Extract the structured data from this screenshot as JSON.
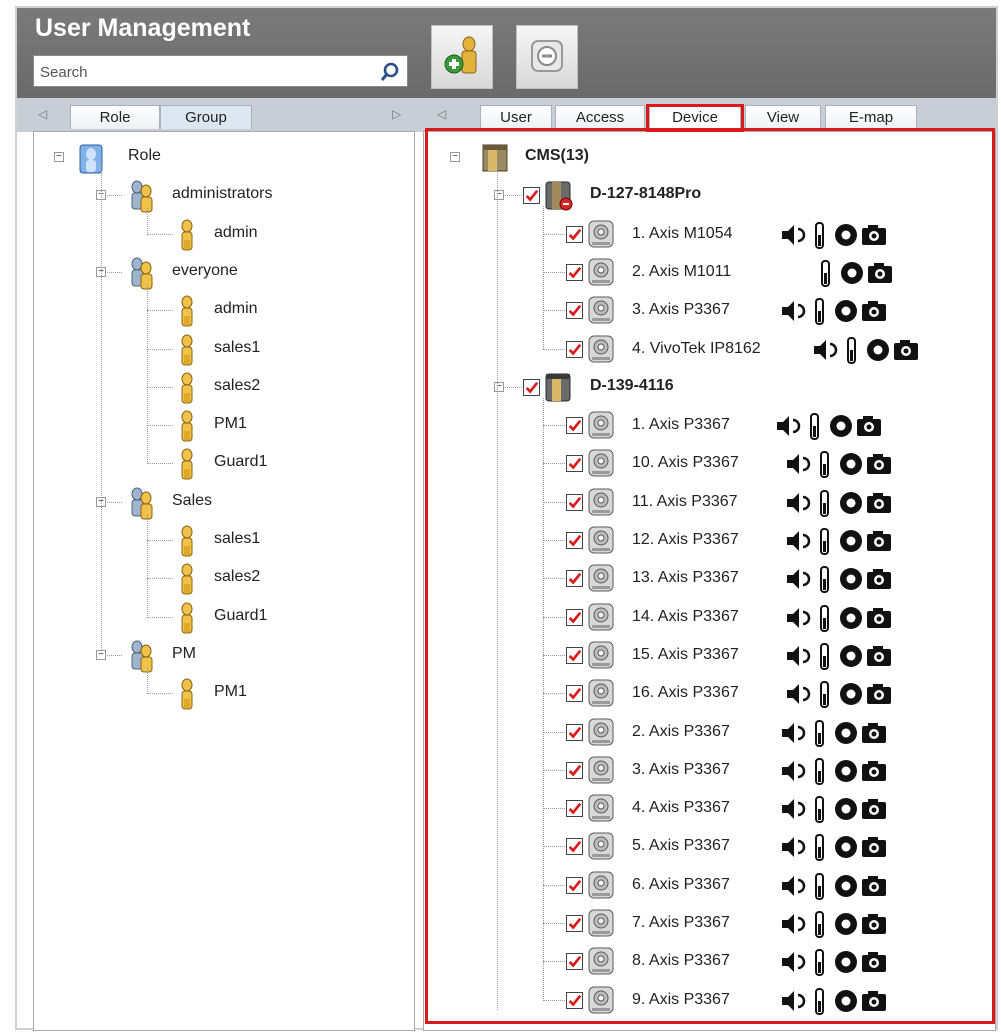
{
  "window": {
    "title": "User Management"
  },
  "search": {
    "placeholder": "Search"
  },
  "toolbar": {
    "add_user_icon": "add-user-icon",
    "remove_icon": "remove-icon"
  },
  "left_tabs": [
    "Role",
    "Group"
  ],
  "right_tabs": [
    "User",
    "Access",
    "Device",
    "View",
    "E-map"
  ],
  "selected_right_tab": "Device",
  "role_tree": {
    "root": "Role",
    "groups": [
      {
        "name": "administrators",
        "members": [
          "admin"
        ]
      },
      {
        "name": "everyone",
        "members": [
          "admin",
          "sales1",
          "sales2",
          "PM1",
          "Guard1"
        ]
      },
      {
        "name": "Sales",
        "members": [
          "sales1",
          "sales2",
          "Guard1"
        ]
      },
      {
        "name": "PM",
        "members": [
          "PM1"
        ]
      }
    ]
  },
  "device_tree": {
    "root": "CMS(13)",
    "servers": [
      {
        "name": "D-127-8148Pro",
        "cameras": [
          {
            "label": "1. Axis M1054",
            "caps": [
              "audio",
              "io",
              "record",
              "snapshot"
            ]
          },
          {
            "label": "2. Axis M1011",
            "caps": [
              "io",
              "record",
              "snapshot"
            ]
          },
          {
            "label": "3. Axis P3367",
            "caps": [
              "audio",
              "io",
              "record",
              "snapshot"
            ]
          },
          {
            "label": "4. VivoTek IP8162",
            "caps": [
              "audio",
              "io",
              "record",
              "snapshot"
            ]
          }
        ]
      },
      {
        "name": "D-139-4116",
        "cameras": [
          {
            "label": "1. Axis P3367",
            "caps": [
              "audio",
              "io",
              "record",
              "snapshot"
            ]
          },
          {
            "label": "10. Axis P3367",
            "caps": [
              "audio",
              "io",
              "record",
              "snapshot"
            ]
          },
          {
            "label": "11. Axis P3367",
            "caps": [
              "audio",
              "io",
              "record",
              "snapshot"
            ]
          },
          {
            "label": "12. Axis P3367",
            "caps": [
              "audio",
              "io",
              "record",
              "snapshot"
            ]
          },
          {
            "label": "13. Axis P3367",
            "caps": [
              "audio",
              "io",
              "record",
              "snapshot"
            ]
          },
          {
            "label": "14. Axis P3367",
            "caps": [
              "audio",
              "io",
              "record",
              "snapshot"
            ]
          },
          {
            "label": "15. Axis P3367",
            "caps": [
              "audio",
              "io",
              "record",
              "snapshot"
            ]
          },
          {
            "label": "16. Axis P3367",
            "caps": [
              "audio",
              "io",
              "record",
              "snapshot"
            ]
          },
          {
            "label": "2. Axis P3367",
            "caps": [
              "audio",
              "io",
              "record",
              "snapshot"
            ]
          },
          {
            "label": "3. Axis P3367",
            "caps": [
              "audio",
              "io",
              "record",
              "snapshot"
            ]
          },
          {
            "label": "4. Axis P3367",
            "caps": [
              "audio",
              "io",
              "record",
              "snapshot"
            ]
          },
          {
            "label": "5. Axis P3367",
            "caps": [
              "audio",
              "io",
              "record",
              "snapshot"
            ]
          },
          {
            "label": "6. Axis P3367",
            "caps": [
              "audio",
              "io",
              "record",
              "snapshot"
            ]
          },
          {
            "label": "7. Axis P3367",
            "caps": [
              "audio",
              "io",
              "record",
              "snapshot"
            ]
          },
          {
            "label": "8. Axis P3367",
            "caps": [
              "audio",
              "io",
              "record",
              "snapshot"
            ]
          },
          {
            "label": "9. Axis P3367",
            "caps": [
              "audio",
              "io",
              "record",
              "snapshot"
            ]
          }
        ]
      }
    ]
  },
  "colors": {
    "header": "#6f6f6f",
    "highlight": "#d91a1a",
    "tab_strip": "#c8ced6"
  }
}
